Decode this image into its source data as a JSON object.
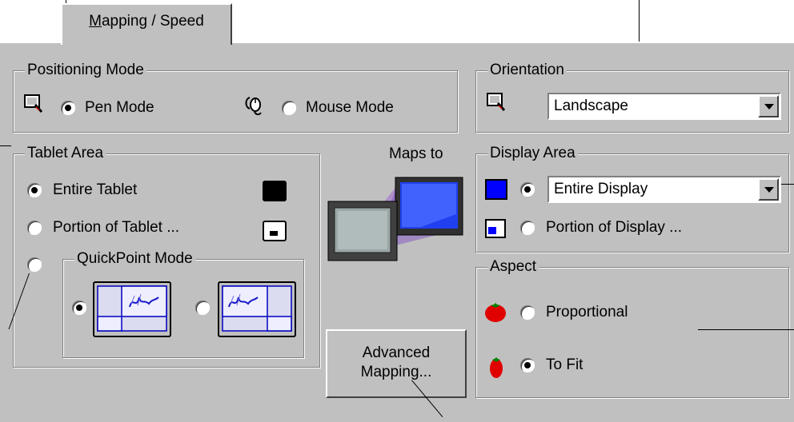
{
  "tab": {
    "label": "Mapping / Speed",
    "accel": "M",
    "rest": "apping / Speed"
  },
  "positioning": {
    "title": "Positioning Mode",
    "pen_label": "Pen Mode",
    "mouse_label": "Mouse Mode",
    "selected": "pen"
  },
  "orientation": {
    "title": "Orientation",
    "value": "Landscape"
  },
  "tablet_area": {
    "title": "Tablet Area",
    "entire_label": "Entire Tablet",
    "portion_label": "Portion of Tablet ...",
    "selected": "entire"
  },
  "quickpoint": {
    "title": "QuickPoint Mode",
    "selected": "left"
  },
  "maps_to": "Maps to",
  "display_area": {
    "title": "Display Area",
    "value": "Entire Display",
    "portion_label": "Portion of Display ...",
    "selected": "entire"
  },
  "aspect": {
    "title": "Aspect",
    "proportional_label": "Proportional",
    "tofit_label": "To Fit",
    "selected": "to_fit"
  },
  "advanced_button": {
    "line1": "Advanced",
    "line2": "Mapping..."
  },
  "colors": {
    "face": "#c0c0c0",
    "display_blue": "#0000ff",
    "tomato_red": "#e00000"
  }
}
